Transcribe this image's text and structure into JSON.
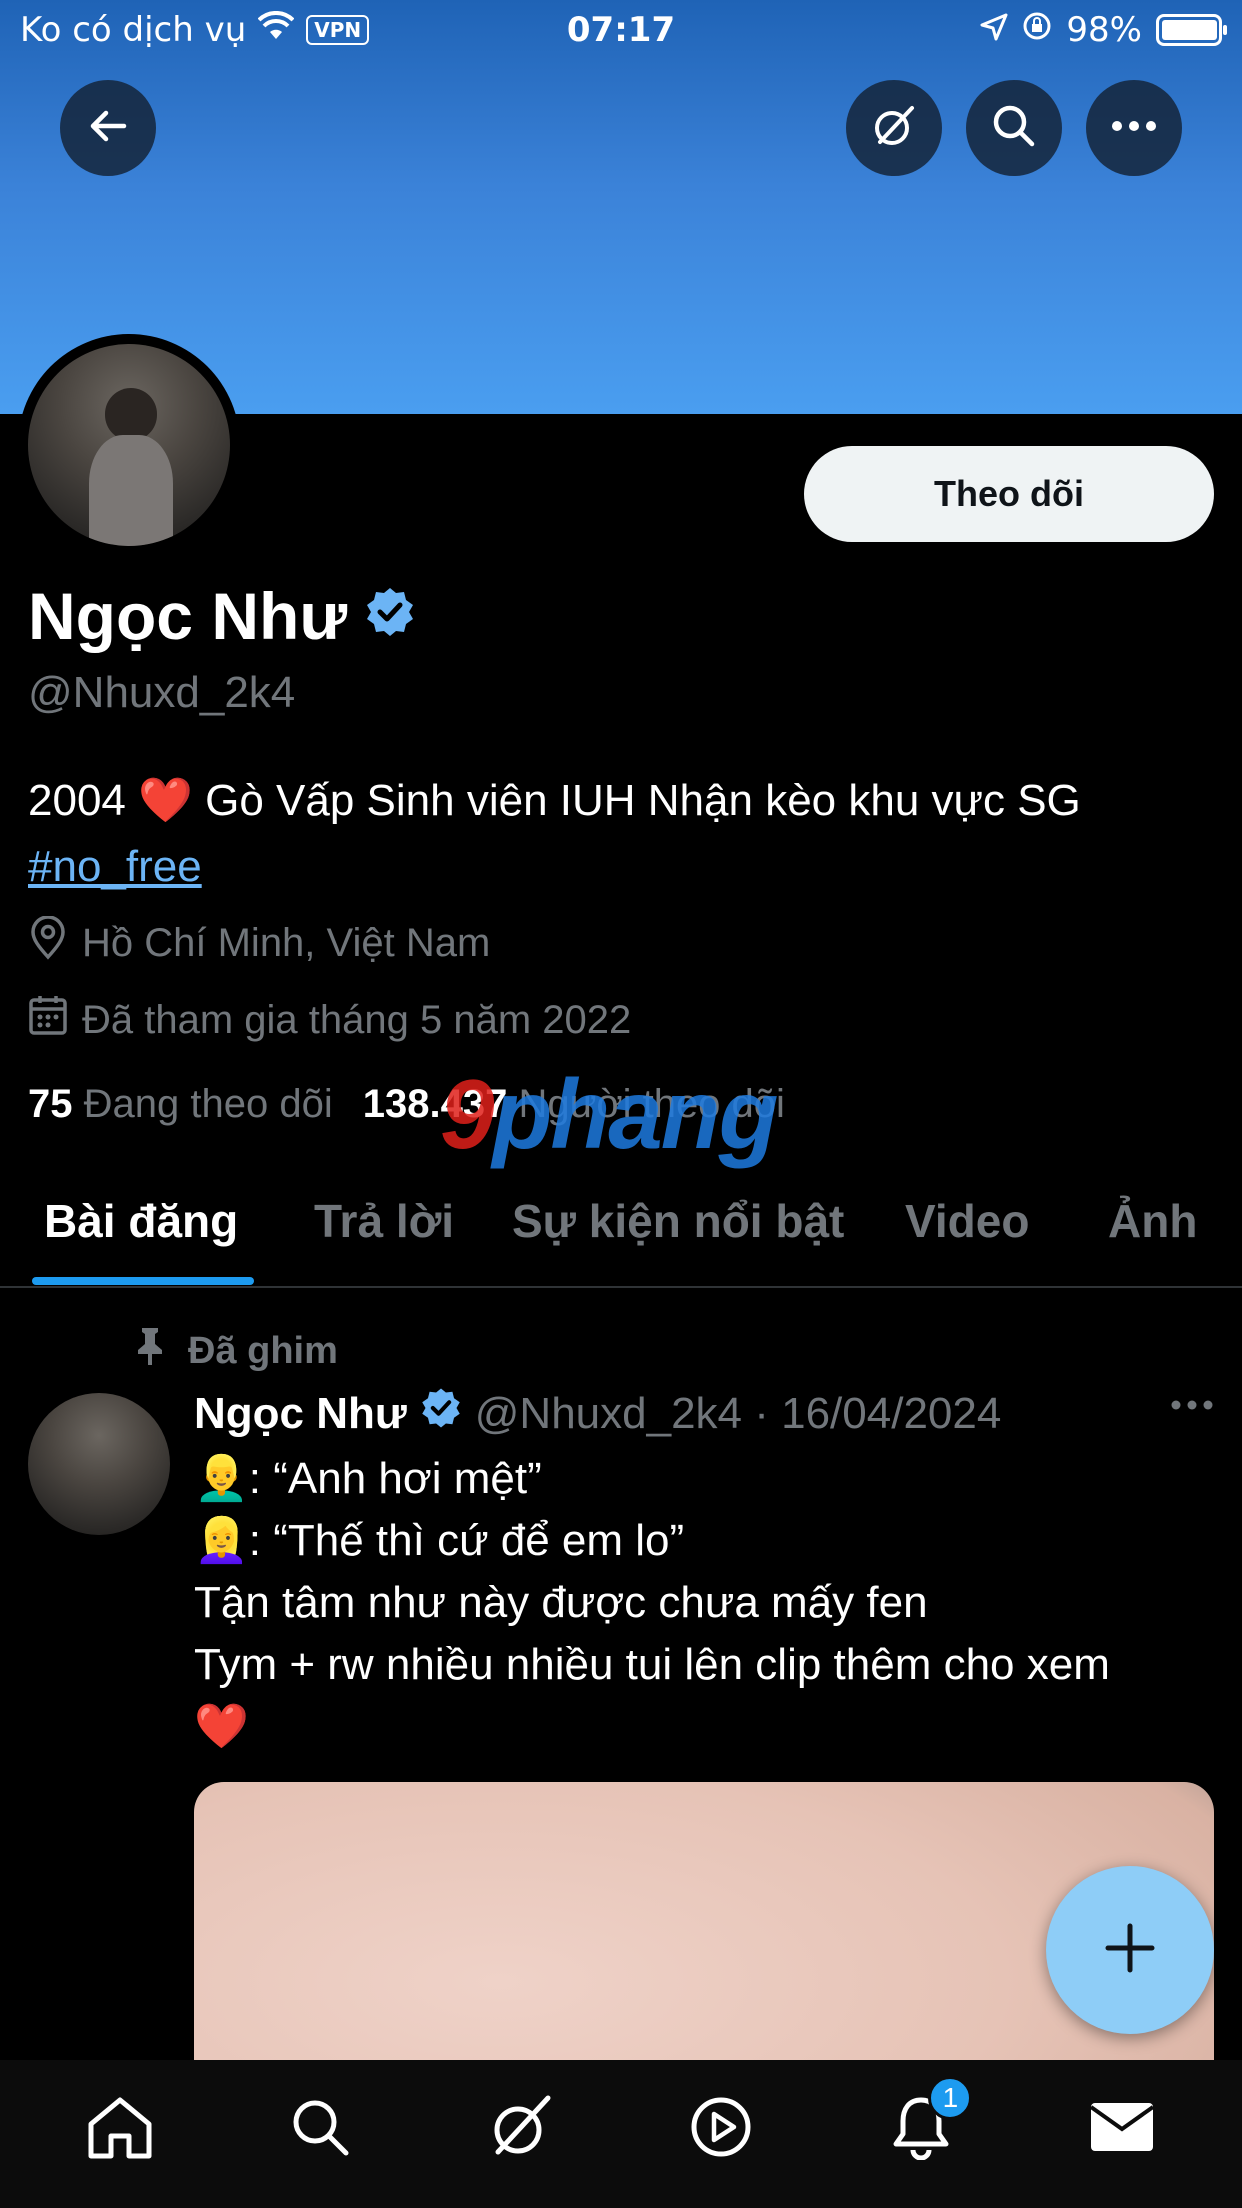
{
  "status_bar": {
    "carrier": "Ko có dịch vụ",
    "vpn": "VPN",
    "time": "07:17",
    "battery": "98%",
    "battery_level": 0.98
  },
  "header": {
    "back_icon": "arrow-left-icon",
    "grok_icon": "grok-icon",
    "search_icon": "search-icon",
    "more_icon": "more-horizontal-icon"
  },
  "profile": {
    "name": "Ngọc Như",
    "handle": "@Nhuxd_2k4",
    "follow_label": "Theo dõi",
    "bio_text": "2004 ❤️ Gò Vấp Sinh viên IUH Nhận kèo khu vực SG",
    "bio_hashtag": "#no_free",
    "location": "Hồ Chí Minh, Việt Nam",
    "joined": "Đã tham gia tháng 5 năm 2022",
    "following_count": "75",
    "following_label": "Đang theo dõi",
    "followers_count": "138.437",
    "followers_label": "Người theo dõi"
  },
  "watermark": {
    "red_part": "9",
    "blue_part": "phang"
  },
  "tabs": [
    {
      "label": "Bài đăng"
    },
    {
      "label": "Trả lời"
    },
    {
      "label": "Sự kiện nổi bật"
    },
    {
      "label": "Video"
    },
    {
      "label": "Ảnh"
    }
  ],
  "post": {
    "pinned_label": "Đã ghim",
    "name": "Ngọc Như",
    "meta": "@Nhuxd_2k4 · 16/04/2024",
    "line1": "👱‍♂️: “Anh hơi mệt”",
    "line2": "👱‍♀️: “Thế thì cứ để em lo”",
    "line3": "Tận tâm như này được chưa mấy fen",
    "line4": "Tym + rw nhiều nhiều tui lên clip thêm cho xem",
    "line5": "❤️"
  },
  "bottom_nav": {
    "notifications_badge": "1"
  },
  "colors": {
    "accent": "#1d9bf0",
    "banner": "#4a9ef0",
    "fab": "#8ecdf7",
    "background": "#000000"
  }
}
